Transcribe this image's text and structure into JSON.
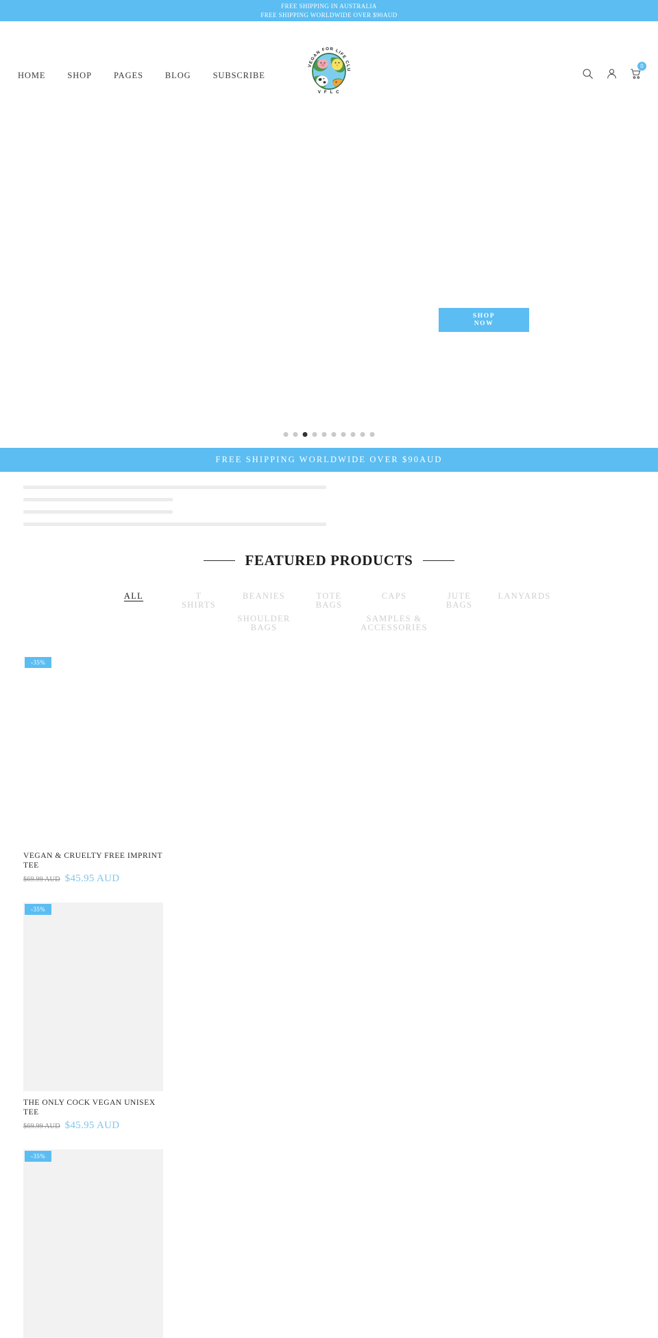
{
  "announcement": {
    "line1": "FREE SHIPPING IN AUSTRALIA",
    "line2": "FREE SHIPPING WORLDWIDE OVER $90AUD"
  },
  "header": {
    "nav": [
      {
        "label": "HOME"
      },
      {
        "label": "SHOP"
      },
      {
        "label": "PAGES"
      },
      {
        "label": "BLOG"
      },
      {
        "label": "SUBSCRIBE"
      }
    ],
    "logo": {
      "arc_text": "VEGAN FOR LIFE CLUB",
      "bottom_text": "V F L C",
      "icon": "globe-with-animals-logo"
    },
    "icons": {
      "search": "search-icon",
      "account": "user-icon",
      "cart": "cart-icon",
      "cart_count": "0"
    }
  },
  "hero": {
    "cta_line1": "SHOP",
    "cta_line2": "NOW",
    "dots_total": 10,
    "dots_active_index": 2
  },
  "shipping_strip": {
    "text": "FREE SHIPPING WORLDWIDE OVER $90AUD"
  },
  "featured": {
    "title": "FEATURED PRODUCTS",
    "filters_row1": [
      {
        "label": "ALL",
        "active": true
      },
      {
        "label": "T\nSHIRTS",
        "active": false
      },
      {
        "label": "BEANIES",
        "active": false
      },
      {
        "label": "TOTE\nBAGS",
        "active": false
      },
      {
        "label": "CAPS",
        "active": false
      },
      {
        "label": "JUTE\nBAGS",
        "active": false
      },
      {
        "label": "LANYARDS",
        "active": false
      }
    ],
    "filters_row2": [
      {
        "label": "SHOULDER\nBAGS",
        "active": false
      },
      {
        "label": "SAMPLES &\nACCESSORIES",
        "active": false
      }
    ],
    "products": [
      {
        "badge": "-35%",
        "title": "VEGAN & CRUELTY FREE IMPRINT TEE",
        "old_price": "$69.99 AUD",
        "new_price": "$45.95 AUD"
      },
      {
        "badge": "-35%",
        "title": "THE ONLY COCK VEGAN UNISEX TEE",
        "old_price": "$69.99 AUD",
        "new_price": "$45.95 AUD"
      },
      {
        "badge": "-35%",
        "title": "",
        "old_price": "",
        "new_price": ""
      }
    ]
  },
  "colors": {
    "accent": "#5bbdf2",
    "price": "#7ec6ea",
    "placeholder": "#f2f2f2"
  }
}
